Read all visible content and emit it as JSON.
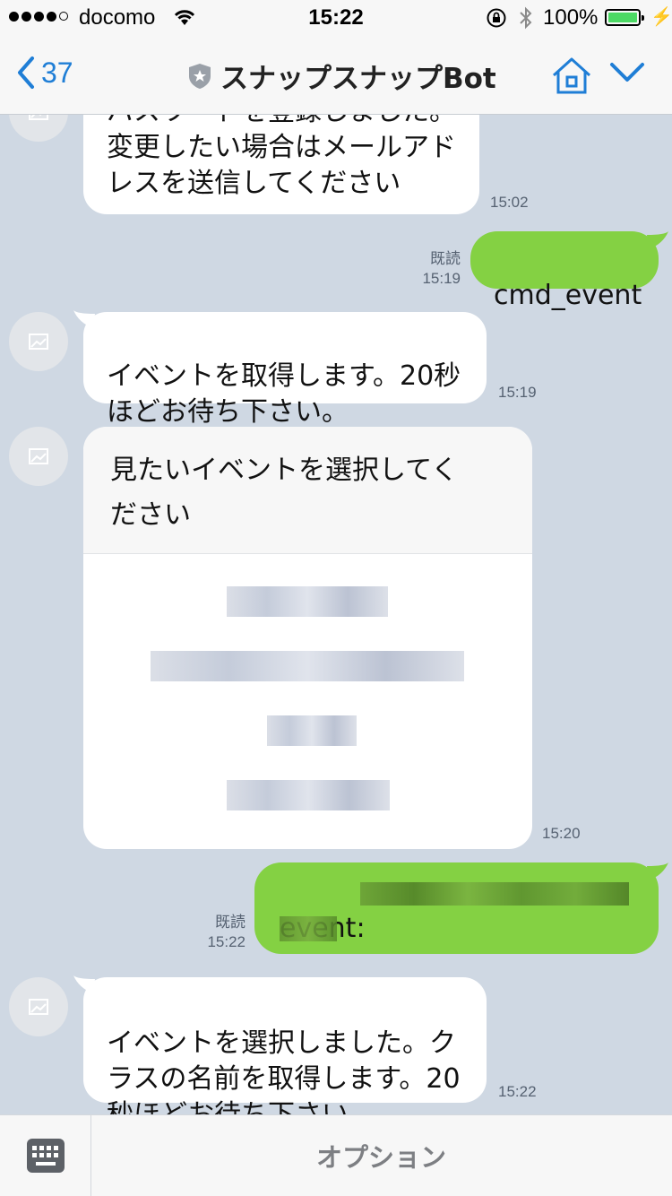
{
  "status_bar": {
    "carrier": "docomo",
    "time": "15:22",
    "battery": "100%"
  },
  "nav": {
    "back_count": "37",
    "title": "スナップスナップBot"
  },
  "messages": [
    {
      "side": "in",
      "text": "パスワードを登録しました。\n変更したい場合はメールアド\nレスを送信してください",
      "time": "15:02"
    },
    {
      "side": "out",
      "text": "cmd_event",
      "read": "既読",
      "time": "15:19"
    },
    {
      "side": "in",
      "text": "イベントを取得します。20秒\nほどお待ち下さい。",
      "time": "15:19"
    },
    {
      "side": "in",
      "card_title": "見たいイベントを選択してく\nださい",
      "time": "15:20"
    },
    {
      "side": "out",
      "text": "event:",
      "read": "既読",
      "time": "15:22"
    },
    {
      "side": "in",
      "text": "イベントを選択しました。ク\nラスの名前を取得します。20\n秒ほどお待ち下さい。",
      "time": "15:22"
    }
  ],
  "bottom": {
    "option_label": "オプション"
  },
  "colors": {
    "chat_bg": "#cfd8e3",
    "outgoing_bubble": "#84d143",
    "link_blue": "#1f7ed6"
  }
}
